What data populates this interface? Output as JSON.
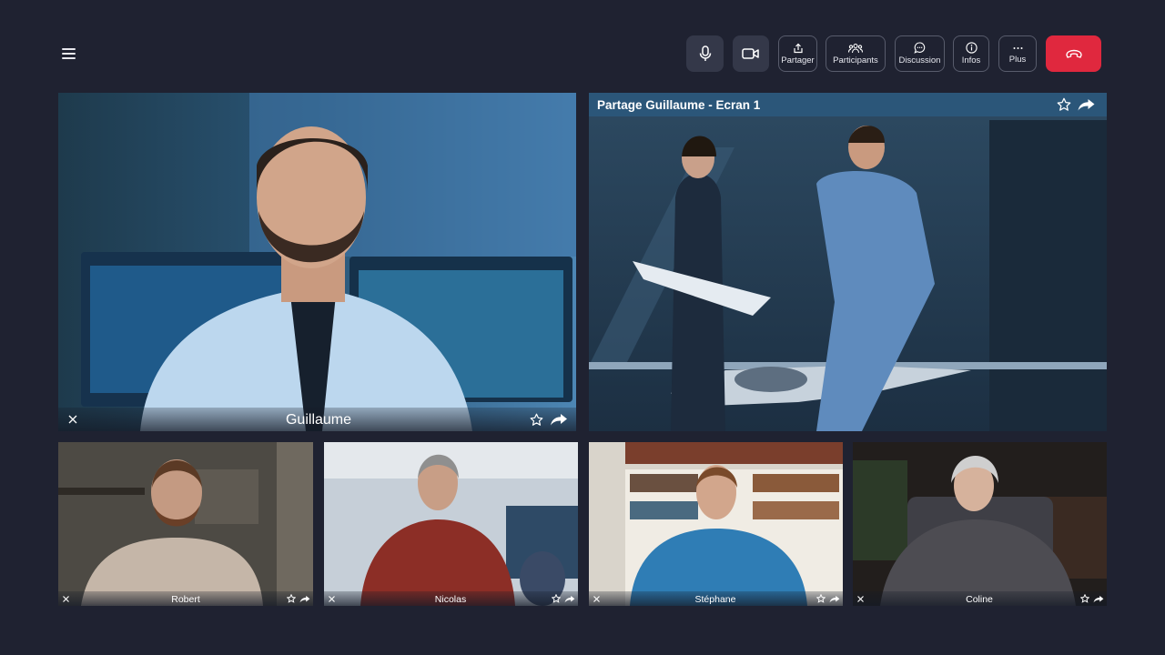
{
  "toolbar": {
    "mic_state": "on",
    "camera_state": "on",
    "share_label": "Partager",
    "participants_label": "Participants",
    "chat_label": "Discussion",
    "info_label": "Infos",
    "more_label": "Plus",
    "end_call_color": "#e0283e"
  },
  "main_speaker": {
    "name": "Guillaume"
  },
  "share": {
    "title": "Partage Guillaume - Ecran 1",
    "bar_color": "#2b5679"
  },
  "participants": [
    {
      "name": "Robert"
    },
    {
      "name": "Nicolas"
    },
    {
      "name": "Stéphane"
    },
    {
      "name": "Coline"
    }
  ],
  "icons": [
    "menu-icon",
    "microphone-icon",
    "camera-icon",
    "share-icon",
    "participants-icon",
    "chat-icon",
    "info-icon",
    "more-icon",
    "hang-up-icon",
    "close-icon",
    "star-icon",
    "forward-icon"
  ],
  "colors": {
    "background": "#1f2231",
    "accent_end": "#e0283e"
  }
}
